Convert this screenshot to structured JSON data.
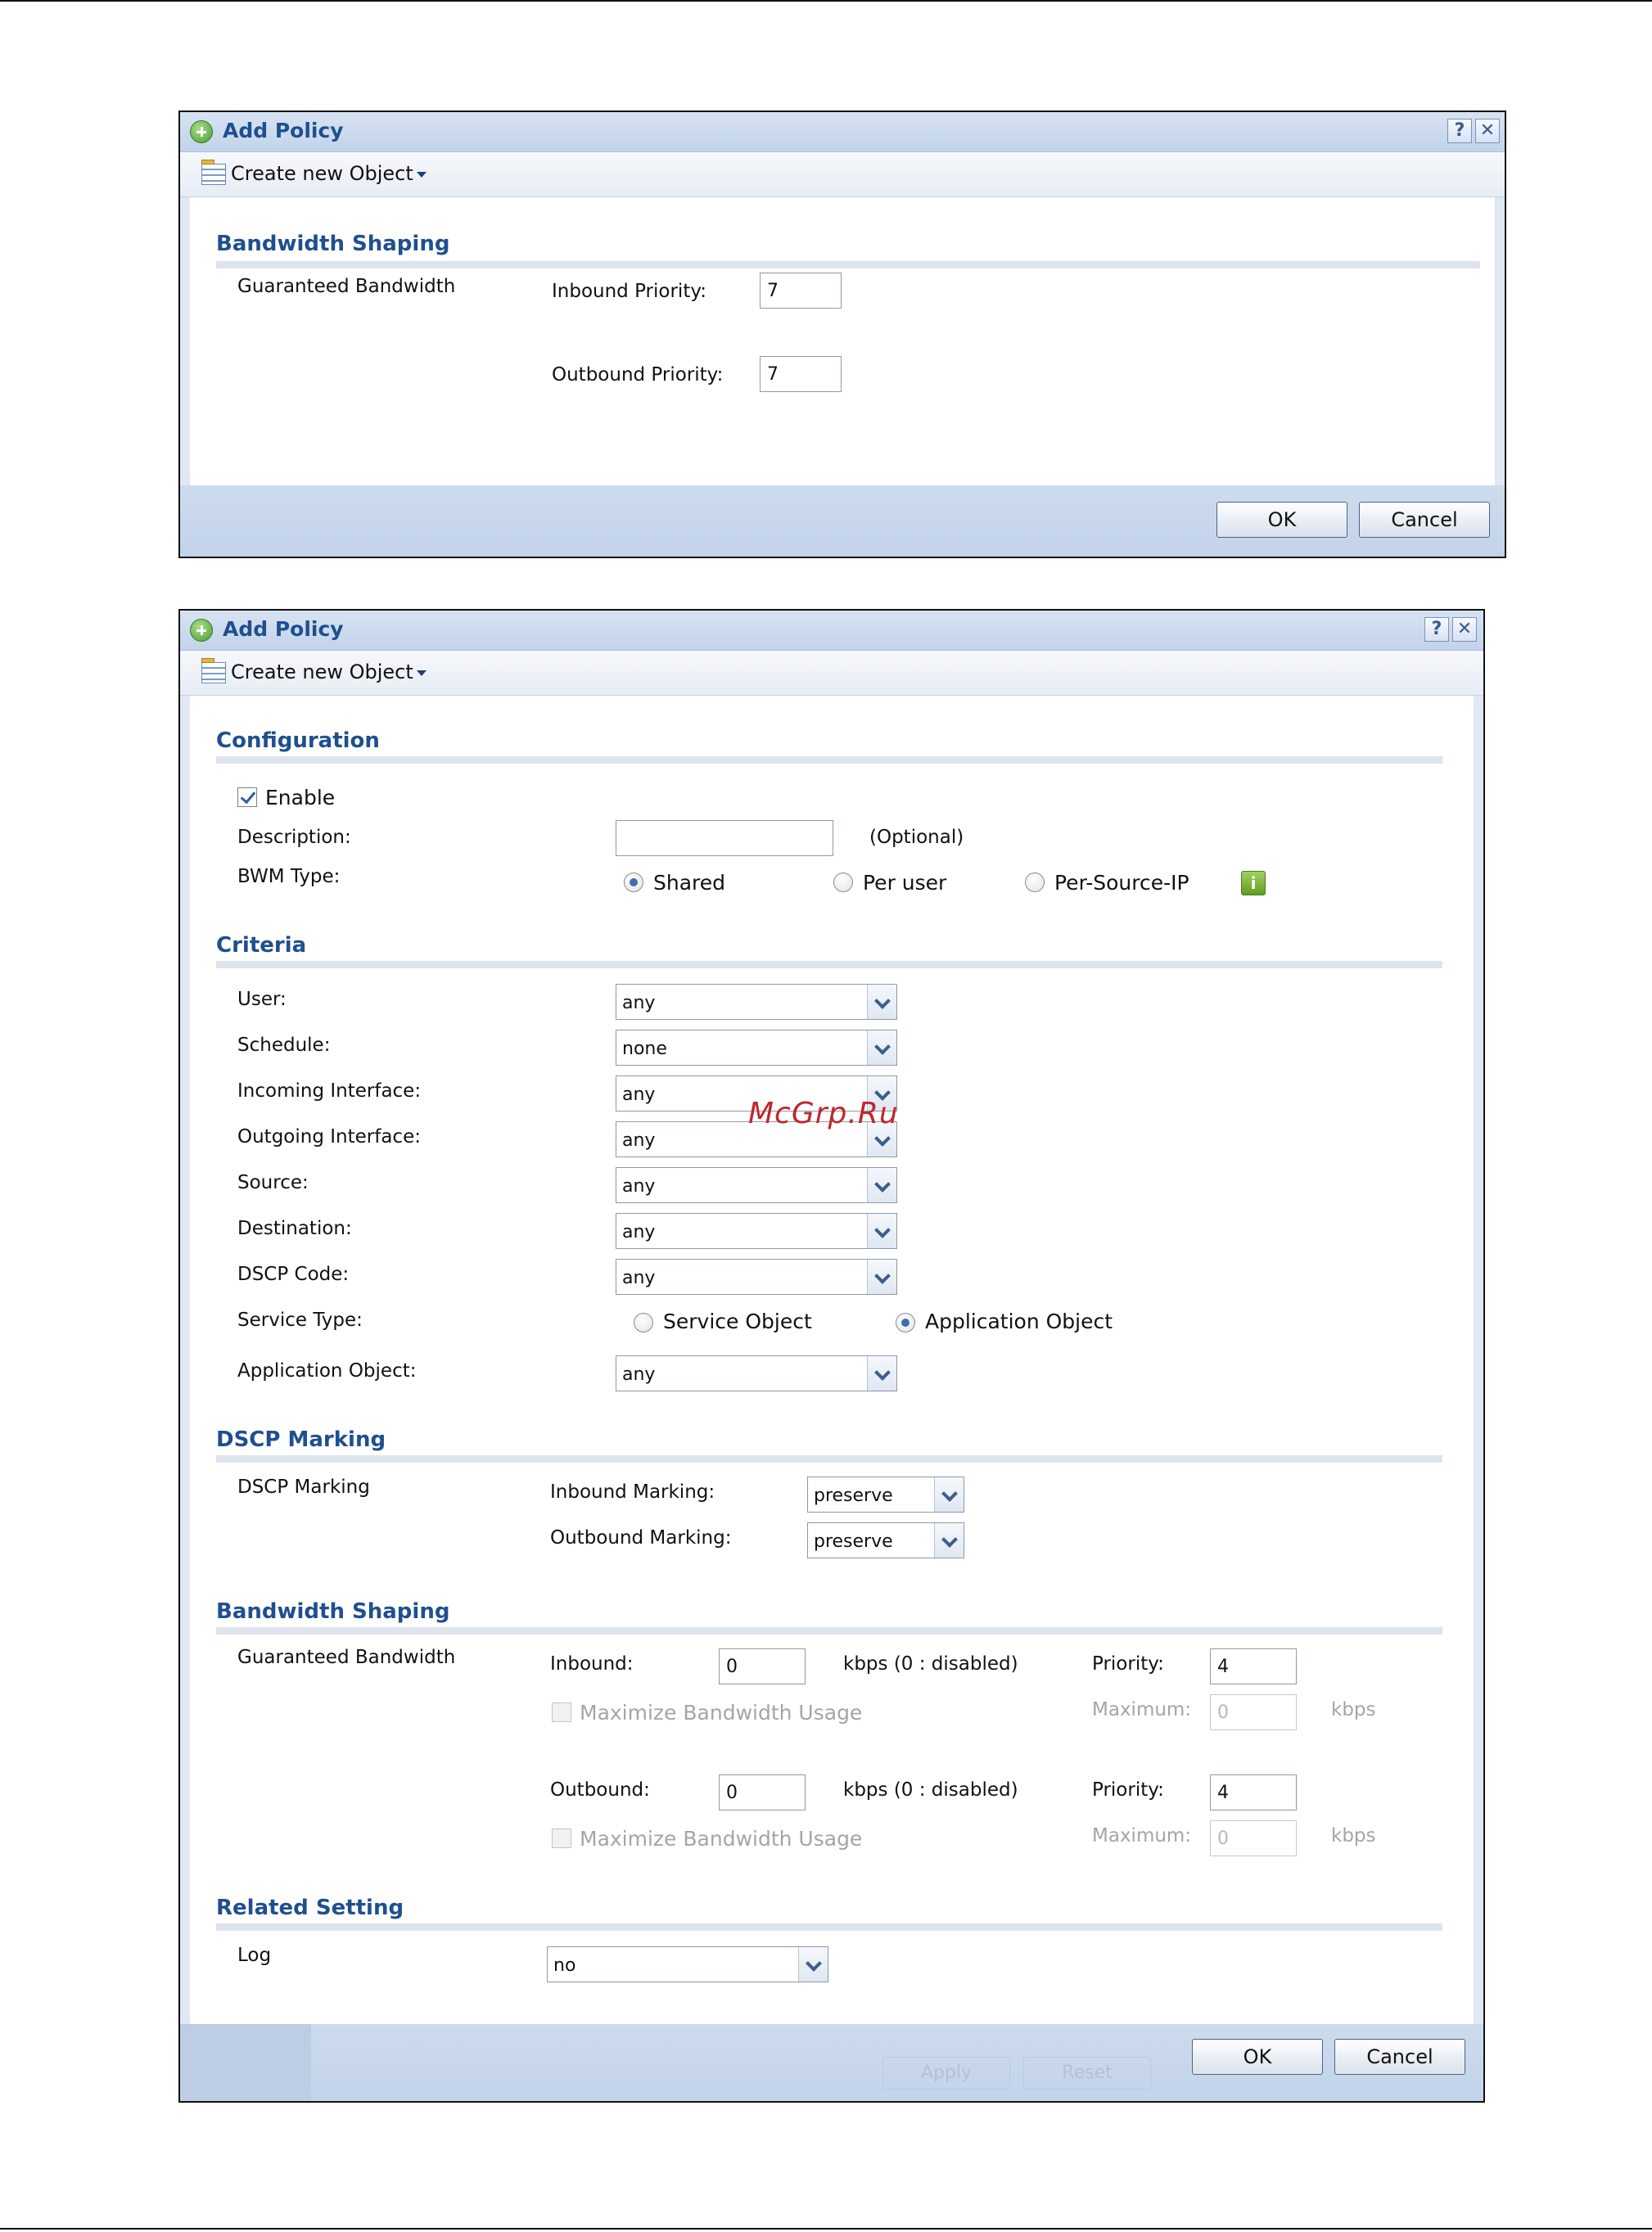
{
  "dialog1": {
    "title": "Add Policy",
    "toolbar_label": "Create new Object",
    "section": "Bandwidth Shaping",
    "row_label": "Guaranteed Bandwidth",
    "inbound_priority_label": "Inbound Priority:",
    "inbound_priority_value": "7",
    "outbound_priority_label": "Outbound Priority:",
    "outbound_priority_value": "7",
    "ok": "OK",
    "cancel": "Cancel"
  },
  "dialog2": {
    "title": "Add Policy",
    "toolbar_label": "Create new Object",
    "configuration": {
      "heading": "Configuration",
      "enable_label": "Enable",
      "enable_checked": true,
      "description_label": "Description:",
      "description_value": "",
      "optional_hint": "(Optional)",
      "bwm_type_label": "BWM Type:",
      "bwm_options": [
        "Shared",
        "Per user",
        "Per-Source-IP"
      ],
      "bwm_selected": "Shared"
    },
    "criteria": {
      "heading": "Criteria",
      "user_label": "User:",
      "user_value": "any",
      "schedule_label": "Schedule:",
      "schedule_value": "none",
      "incoming_label": "Incoming Interface:",
      "incoming_value": "any",
      "outgoing_label": "Outgoing Interface:",
      "outgoing_value": "any",
      "source_label": "Source:",
      "source_value": "any",
      "destination_label": "Destination:",
      "destination_value": "any",
      "dscp_label": "DSCP Code:",
      "dscp_value": "any",
      "service_type_label": "Service Type:",
      "service_options": [
        "Service Object",
        "Application Object"
      ],
      "service_selected": "Application Object",
      "app_object_label": "Application Object:",
      "app_object_value": "any"
    },
    "dscp_marking": {
      "heading": "DSCP Marking",
      "row_label": "DSCP Marking",
      "inbound_label": "Inbound Marking:",
      "inbound_value": "preserve",
      "outbound_label": "Outbound Marking:",
      "outbound_value": "preserve"
    },
    "bandwidth_shaping": {
      "heading": "Bandwidth Shaping",
      "row_label": "Guaranteed Bandwidth",
      "inbound_label": "Inbound:",
      "inbound_value": "0",
      "unit_hint": "kbps (0 : disabled)",
      "priority_label": "Priority:",
      "inbound_priority": "4",
      "maximize_label": "Maximize Bandwidth Usage",
      "maximum_label": "Maximum:",
      "inbound_maximum": "0",
      "kbps": "kbps",
      "outbound_label": "Outbound:",
      "outbound_value": "0",
      "outbound_priority": "4",
      "outbound_maximum": "0"
    },
    "related": {
      "heading": "Related Setting",
      "log_label": "Log",
      "log_value": "no"
    },
    "ghost_apply": "Apply",
    "ghost_reset": "Reset",
    "ok": "OK",
    "cancel": "Cancel"
  },
  "watermark": "McGrp.Ru",
  "colors": {
    "heading": "#1f4f8f",
    "footer": "#c8d7eb",
    "watermark": "#c0262d"
  }
}
